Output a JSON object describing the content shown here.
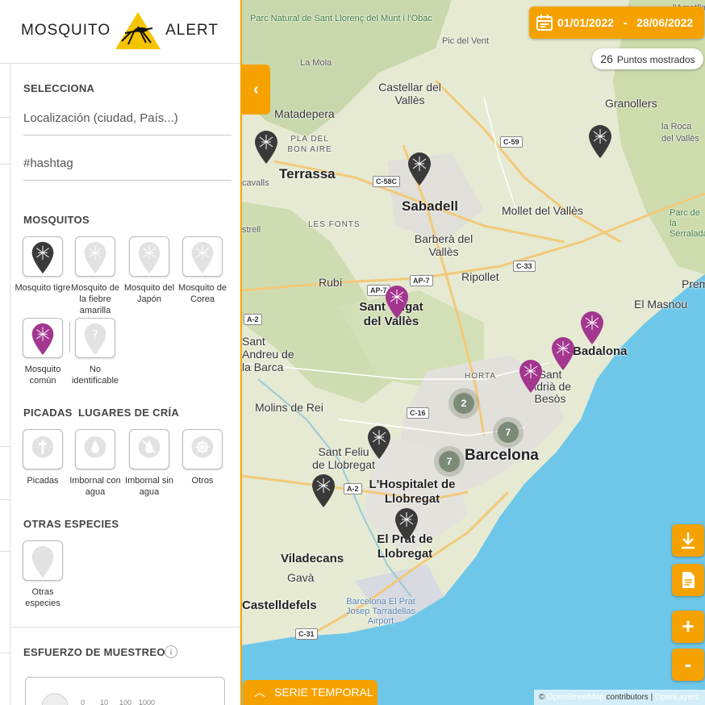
{
  "app": {
    "logo_left": "MOSQUITO",
    "logo_right": "ALERT"
  },
  "sidebar": {
    "select_title": "SELECCIONA",
    "location_placeholder": "Localización (ciudad, País...)",
    "hashtag_placeholder": "#hashtag",
    "mosquitos_title": "MOSQUITOS",
    "mosquitos": [
      {
        "label": "Mosquito tigre",
        "icon": "tiger-mosquito-icon",
        "color": "#3a3a3a"
      },
      {
        "label": "Mosquito de la fiebre amarilla",
        "icon": "yellow-fever-mosquito-icon",
        "color": "#d8d8d8"
      },
      {
        "label": "Mosquito del Japón",
        "icon": "japan-mosquito-icon",
        "color": "#d8d8d8"
      },
      {
        "label": "Mosquito de Corea",
        "icon": "korea-mosquito-icon",
        "color": "#d8d8d8"
      },
      {
        "label": "Mosquito común",
        "icon": "common-mosquito-icon",
        "color": "#a3368f"
      },
      {
        "label": "No identificable",
        "icon": "unidentifiable-icon",
        "color": "#d8d8d8"
      }
    ],
    "picadas_title": "PICADAS",
    "lugares_title": "LUGARES DE CRÍA",
    "picadas": [
      {
        "label": "Picadas",
        "icon": "bite-icon"
      }
    ],
    "lugares": [
      {
        "label": "Imbornal con agua",
        "icon": "drain-water-icon"
      },
      {
        "label": "Imbornal sin agua",
        "icon": "drain-dry-icon"
      },
      {
        "label": "Otros",
        "icon": "other-breeding-icon"
      }
    ],
    "otras_title": "OTRAS ESPECIES",
    "otras": [
      {
        "label": "Otras especies",
        "icon": "other-species-icon"
      }
    ],
    "esfuerzo_title": "ESFUERZO DE MUESTREO",
    "info_glyph": "i",
    "scale_labels": [
      "0",
      "10",
      "100",
      "1000"
    ]
  },
  "toolbar": {
    "date_range": "01/01/2022   -   28/06/2022",
    "points_count": "26",
    "points_label": "Puntos mostrados",
    "download_icon": "download-icon",
    "report_icon": "report-icon",
    "zoom_in": "+",
    "zoom_out": "-",
    "serie_temporal": "SERIE TEMPORAL",
    "attribution_prefix": "©",
    "attribution_osm": "OpenStreetMap",
    "attribution_contrib": "contributors |",
    "attribution_carto": "OpenLayers"
  },
  "map": {
    "labels": {
      "terrassa": "Terrassa",
      "sabadell": "Sabadell",
      "granollers": "Granollers",
      "castellar": "Castellar del Vallès",
      "matadepera": "Matadepera",
      "pla": "PLA DEL BON AIRE",
      "mollet": "Mollet del Vallès",
      "barbera": "Barberà del Vallès",
      "rubi": "Rubí",
      "ripollet": "Ripollet",
      "santcugat": "Sant Cugat del Vallès",
      "lesfonts": "LES FONTS",
      "santandreu": "Sant Andreu de la Barca",
      "molins": "Molins de Rei",
      "santfeliu": "Sant Feliu de Llobregat",
      "hospitalet": "L'Hospitalet de Llobregat",
      "barcelona": "Barcelona",
      "elprat": "El Prat de Llobregat",
      "viladecans": "Viladecans",
      "gava": "Gavà",
      "castelldefels": "Castelldefels",
      "airport": "Barcelona El Prat Josep Tarradellas Airport",
      "badalona": "Badalona",
      "santadria": "Sant Adrià de Besòs",
      "horta": "HORTA",
      "elmasnou": "El Masnou",
      "larocca": "la Roca del Vallès",
      "parcserralada": "Parc de la Serralada",
      "parcnatural": "Parc Natural de Sant Llorenç del Munt i l'Obac",
      "picdelvent": "Pic del Vent",
      "lamola": "La Mola",
      "lametlla": "l'Ametlla",
      "prem": "Prem",
      "cavalls": "cavalls",
      "strell": "strell",
      "r_c58c": "C-58C",
      "r_c59": "C-59",
      "r_c33": "C-33",
      "r_ap7a": "AP-7",
      "r_ap7b": "AP-7",
      "r_a2a": "A-2",
      "r_a2b": "A-2",
      "r_c16": "C-16",
      "r_c31": "C-31"
    },
    "clusters": [
      "2",
      "7",
      "7"
    ]
  }
}
